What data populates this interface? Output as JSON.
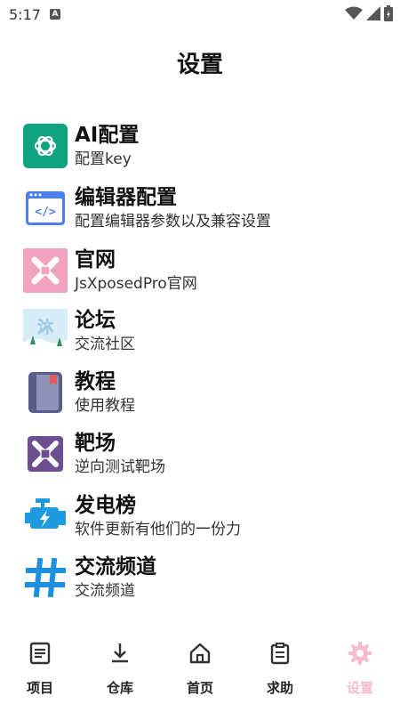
{
  "status_bar": {
    "time": "5:17",
    "notif": "A"
  },
  "page": {
    "title": "设置"
  },
  "items": [
    {
      "title": "AI配置",
      "subtitle": "配置key",
      "icon": "openai-icon",
      "color": "#10a37f"
    },
    {
      "title": "编辑器配置",
      "subtitle": "配置编辑器参数以及兼容设置",
      "icon": "code-editor-icon",
      "color": "#4c7ef0"
    },
    {
      "title": "官网",
      "subtitle": "JsXposedPro官网",
      "icon": "website-logo-icon",
      "color": "#f3a3c0"
    },
    {
      "title": "论坛",
      "subtitle": "交流社区",
      "icon": "forum-icon",
      "color": "#cfe8f6"
    },
    {
      "title": "教程",
      "subtitle": "使用教程",
      "icon": "book-icon",
      "color": "#5a5d8a"
    },
    {
      "title": "靶场",
      "subtitle": "逆向测试靶场",
      "icon": "target-range-icon",
      "color": "#6d4e91"
    },
    {
      "title": "发电榜",
      "subtitle": "软件更新有他们的一份力",
      "icon": "engine-icon",
      "color": "#1e9be0"
    },
    {
      "title": "交流频道",
      "subtitle": "交流频道",
      "icon": "hashtag-icon",
      "color": "#1e8fe0"
    }
  ],
  "bottom_nav": [
    {
      "label": "项目",
      "icon": "document-icon"
    },
    {
      "label": "仓库",
      "icon": "download-icon"
    },
    {
      "label": "首页",
      "icon": "home-icon"
    },
    {
      "label": "求助",
      "icon": "clipboard-icon"
    },
    {
      "label": "设置",
      "icon": "gear-icon",
      "active": true,
      "color": "#f7bcd0"
    }
  ]
}
